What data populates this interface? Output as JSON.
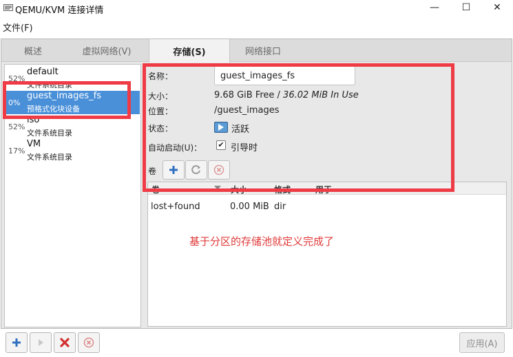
{
  "window": {
    "title": "QEMU/KVM 连接详情",
    "minimize_glyph": "—",
    "maximize_glyph": "☐",
    "close_glyph": "✕"
  },
  "menubar": {
    "file_label": "文件(F)"
  },
  "tabs": [
    {
      "label": "概述"
    },
    {
      "label": "虚拟网络(V)"
    },
    {
      "label": "存储(S)"
    },
    {
      "label": "网络接口"
    }
  ],
  "pools": [
    {
      "percent": "52%",
      "name": "default",
      "type": "文件系统目录"
    },
    {
      "percent": "0%",
      "name": "guest_images_fs",
      "type": "预格式化块设备"
    },
    {
      "percent": "52%",
      "name": "iso",
      "type": "文件系统目录"
    },
    {
      "percent": "17%",
      "name": "VM",
      "type": "文件系统目录"
    }
  ],
  "details": {
    "name_label": "名称：",
    "name_value": "guest_images_fs",
    "size_label": "大小：",
    "size_free": "9.68 GiB Free / ",
    "size_used": "36.02 MiB In Use",
    "location_label": "位置：",
    "location_value": "/guest_images",
    "state_label": "状态：",
    "state_value": "活跃",
    "autostart_label": "自动启动(U)：",
    "autostart_value": "引导时",
    "volumes_label": "卷"
  },
  "volume_table": {
    "headers": [
      "卷",
      "大小",
      "格式",
      "用于"
    ],
    "rows": [
      {
        "name": "lost+found",
        "size": "0.00 MiB",
        "format": "dir",
        "used_by": ""
      }
    ]
  },
  "annotation": {
    "text": "基于分区的存储池就定义完成了"
  },
  "bottom": {
    "apply_label": "应用(A)"
  },
  "colors": {
    "selection": "#4a90d9",
    "annotation_box": "#ef3b45",
    "annotation_text": "#e03a3a",
    "delete_red": "#d22f2f",
    "add_blue": "#2f6fbf"
  },
  "icons": [
    "app-icon",
    "add-icon",
    "refresh-icon",
    "stop-icon",
    "play-icon",
    "delete-icon",
    "status-running-icon",
    "check-icon",
    "sort-arrow-icon"
  ]
}
